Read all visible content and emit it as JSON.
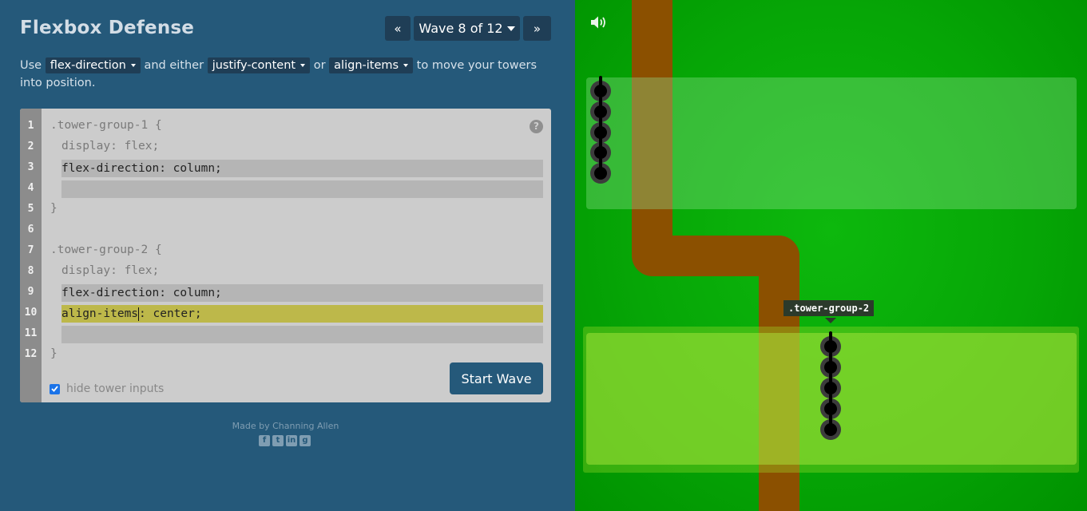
{
  "app": {
    "title": "Flexbox Defense"
  },
  "wave_nav": {
    "prev": "«",
    "next": "»",
    "current": "Wave 8 of 12"
  },
  "instructions": {
    "t1": "Use ",
    "dd1": "flex-direction",
    "t2": " and either ",
    "dd2": "justify-content",
    "t3": " or ",
    "dd3": "align-items",
    "t4": " to move your towers into position."
  },
  "editor": {
    "line_numbers": [
      "1",
      "2",
      "3",
      "4",
      "5",
      "6",
      "7",
      "8",
      "9",
      "10",
      "11",
      "12"
    ],
    "g1_selector": ".tower-group-1 {",
    "g1_display": "display: flex;",
    "g1_input1": "flex-direction: column;",
    "g1_input2": "",
    "g1_close": "}",
    "g2_selector": ".tower-group-2 {",
    "g2_display": "display: flex;",
    "g2_input1": "flex-direction: column;",
    "g2_input2_a": "align-items",
    "g2_input2_b": ": center;",
    "g2_input3": "",
    "g2_close": "}",
    "help": "?",
    "hide_inputs_label": "hide tower inputs",
    "hide_inputs_checked": true,
    "start_wave": "Start Wave"
  },
  "footer": {
    "credit": "Made by Channing Allen",
    "social_icons": [
      "facebook-icon",
      "twitter-icon",
      "linkedin-icon",
      "github-icon"
    ]
  },
  "board": {
    "tooltip": ".tower-group-2",
    "group1_towers": 5,
    "group2_towers": 5
  },
  "colors": {
    "panel": "#25597a",
    "dark_button": "#1f3e56",
    "grass": "#06a606",
    "path": "#8b5000",
    "highlight": "#bdb84a"
  }
}
